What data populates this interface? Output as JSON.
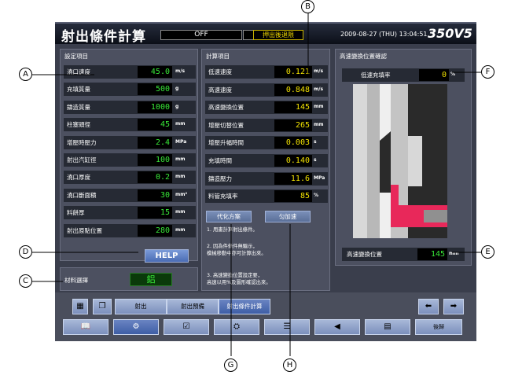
{
  "header": {
    "title": "射出條件計算",
    "mode": "OFF",
    "pressure_status": "押出後退限",
    "datetime": "2009-08-27 (THU) 13:04:51",
    "brand": "350V5"
  },
  "settings": {
    "title": "設定項目",
    "rows": [
      {
        "label": "澆口速度",
        "value": "45.0",
        "unit": "m/s"
      },
      {
        "label": "充填質量",
        "value": "500",
        "unit": "g"
      },
      {
        "label": "鑄造質量",
        "value": "1000",
        "unit": "g"
      },
      {
        "label": "柱塞頭徑",
        "value": "45",
        "unit": "mm"
      },
      {
        "label": "增壓時壓力",
        "value": "2.4",
        "unit": "MPa"
      },
      {
        "label": "射出汽缸徑",
        "value": "100",
        "unit": "mm"
      },
      {
        "label": "澆口厚度",
        "value": "0.2",
        "unit": "mm"
      },
      {
        "label": "澆口斷面積",
        "value": "30",
        "unit": "mm²"
      },
      {
        "label": "料餅厚",
        "value": "15",
        "unit": "mm"
      },
      {
        "label": "射出原點位置",
        "value": "280",
        "unit": "mm"
      }
    ],
    "help_label": "HELP"
  },
  "material": {
    "label": "材料選擇",
    "value": "鋁"
  },
  "calc": {
    "title": "計算項目",
    "rows": [
      {
        "label": "低速速度",
        "value": "0.121",
        "unit": "m/s"
      },
      {
        "label": "高速速度",
        "value": "0.848",
        "unit": "m/s"
      },
      {
        "label": "高速變換位置",
        "value": "145",
        "unit": "mm"
      },
      {
        "label": "增壓切替位置",
        "value": "265",
        "unit": "mm"
      },
      {
        "label": "增壓升幅時間",
        "value": "0.003",
        "unit": "s"
      },
      {
        "label": "充填時間",
        "value": "0.140",
        "unit": "s"
      },
      {
        "label": "鑄造壓力",
        "value": "11.6",
        "unit": "MPa"
      },
      {
        "label": "料管充填率",
        "value": "85",
        "unit": "%"
      }
    ],
    "optimize_label": "代化方案",
    "apply_label": "匀加速",
    "notes": [
      "1. 用畫計算射出條件。",
      "2. 因為件條件無驅示，",
      "   模械移動中亦可計算出來。",
      "3. 高速變換位置設定要，",
      "   高速以用%及圖形確認出來。"
    ]
  },
  "confirm": {
    "title": "高速變換位置確認",
    "fill_rate_label": "低速充填率",
    "fill_rate_value": "0",
    "fill_rate_unit": "%",
    "position_label": "高速變換位置",
    "position_value": "145",
    "position_unit": "mm",
    "fill_fraction": 0.0
  },
  "nav": {
    "row1": [
      "射出",
      "射出預備",
      "射出條件計算"
    ],
    "row2_last": "後歸"
  },
  "callouts": [
    "A",
    "B",
    "C",
    "D",
    "E",
    "F",
    "G",
    "H"
  ],
  "colors": {
    "value_green": "#38e838",
    "value_yellow": "#f2e200",
    "plunger_red": "#e8285a"
  }
}
